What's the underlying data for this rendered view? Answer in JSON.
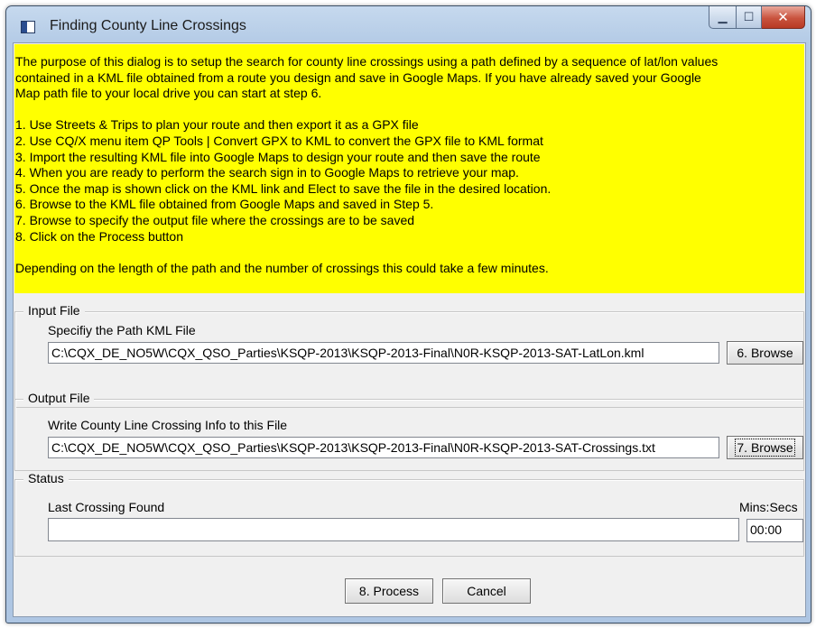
{
  "window": {
    "title": "Finding County Line Crossings",
    "minimize_glyph": "▁",
    "maximize_glyph": "☐",
    "close_glyph": "✕"
  },
  "instructions": {
    "lines": [
      "The purpose of this dialog is to setup the search for county line crossings using a path defined by a sequence of lat/lon values",
      "contained in a KML file obtained from a route you design and save in Google Maps.  If you have already saved your Google",
      "Map path file to your local drive you can start at step 6.",
      "",
      "1. Use Streets & Trips to plan your route and then export it as a GPX file",
      "2. Use CQ/X menu item QP Tools | Convert GPX to KML to convert the GPX file to KML format",
      "3. Import the resulting KML file into Google Maps to design your route and then save the route",
      "4. When you are ready to perform the search sign in to Google Maps to retrieve your map.",
      "5. Once the map is shown click on the KML link and Elect to save the file in the desired location.",
      "6. Browse to the KML file obtained from Google Maps and saved in Step 5.",
      "7. Browse to specify the output file where the crossings are to be saved",
      "8. Click on the Process button",
      "",
      "Depending on the length of the path and the number of crossings this could take a few minutes."
    ]
  },
  "input_file": {
    "group_label": "Input File",
    "prompt": "Specifiy the Path KML File",
    "path": "C:\\CQX_DE_NO5W\\CQX_QSO_Parties\\KSQP-2013\\KSQP-2013-Final\\N0R-KSQP-2013-SAT-LatLon.kml",
    "browse_label": "6. Browse"
  },
  "output_file": {
    "group_label": "Output File",
    "prompt": "Write County Line Crossing Info to this File",
    "path": "C:\\CQX_DE_NO5W\\CQX_QSO_Parties\\KSQP-2013\\KSQP-2013-Final\\N0R-KSQP-2013-SAT-Crossings.txt",
    "browse_label": "7. Browse"
  },
  "status": {
    "group_label": "Status",
    "last_crossing_label": "Last Crossing Found",
    "last_crossing_value": "",
    "time_label": "Mins:Secs",
    "time_value": "00:00"
  },
  "buttons": {
    "process": "8. Process",
    "cancel": "Cancel"
  }
}
